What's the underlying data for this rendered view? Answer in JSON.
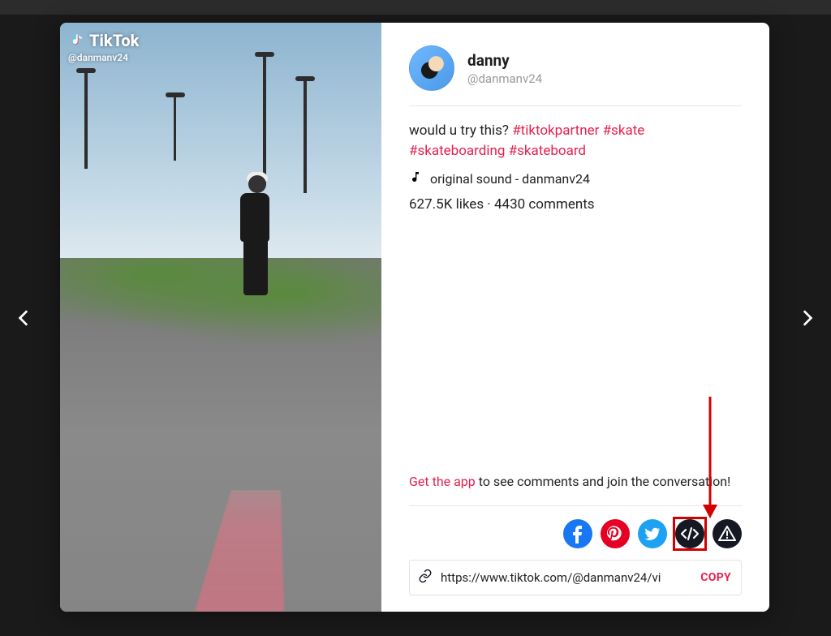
{
  "watermark": {
    "brand": "TikTok",
    "handle": "@danmanv24"
  },
  "profile": {
    "name": "danny",
    "handle": "@danmanv24"
  },
  "caption": {
    "text": "would u try this? ",
    "tags": [
      "#tiktokpartner",
      "#skate",
      "#skateboarding",
      "#skateboard"
    ]
  },
  "music": {
    "label": "original sound - danmanv24"
  },
  "stats": {
    "likes": "627.5K likes",
    "separator": " · ",
    "comments": "4430 comments"
  },
  "get_app": {
    "cta": "Get the app",
    "rest": " to see comments and join the conversation!"
  },
  "share": {
    "facebook": "facebook",
    "pinterest": "pinterest",
    "twitter": "twitter",
    "embed": "embed",
    "report": "report"
  },
  "url_row": {
    "url": "https://www.tiktok.com/@danmanv24/vi",
    "copy": "COPY"
  }
}
